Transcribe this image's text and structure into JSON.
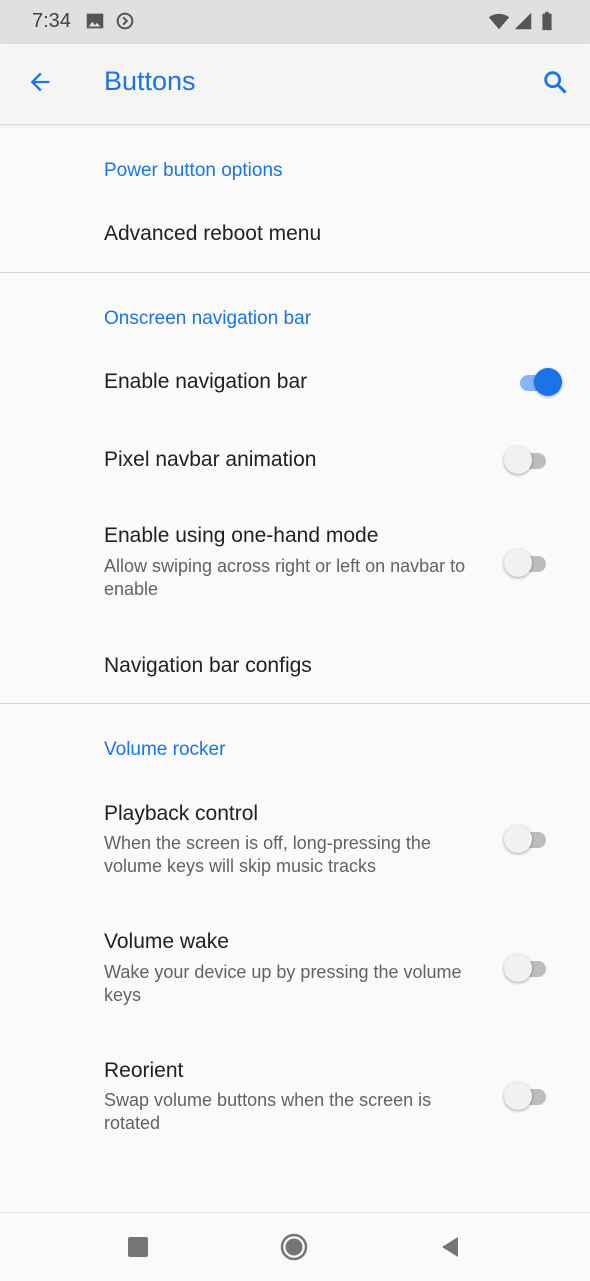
{
  "status_bar": {
    "time": "7:34",
    "icons": [
      "image-icon",
      "sync-icon",
      "wifi-icon",
      "signal-icon",
      "battery-icon"
    ]
  },
  "app_bar": {
    "title": "Buttons",
    "back_icon": "arrow-back-icon",
    "search_icon": "search-icon"
  },
  "sections": {
    "power": {
      "header": "Power button options",
      "advanced_reboot": "Advanced reboot menu"
    },
    "navbar": {
      "header": "Onscreen navigation bar",
      "enable_navbar": {
        "title": "Enable navigation bar",
        "checked": true
      },
      "pixel_anim": {
        "title": "Pixel navbar animation",
        "checked": false
      },
      "one_hand": {
        "title": "Enable using one-hand mode",
        "summary": "Allow swiping across right or left on navbar to enable",
        "checked": false
      },
      "configs": "Navigation bar configs"
    },
    "volume": {
      "header": "Volume rocker",
      "playback": {
        "title": "Playback control",
        "summary": "When the screen is off, long-pressing the volume keys will skip music tracks",
        "checked": false
      },
      "wake": {
        "title": "Volume wake",
        "summary": "Wake your device up by pressing the volume keys",
        "checked": false
      },
      "reorient": {
        "title": "Reorient",
        "summary": "Swap volume buttons when the screen is rotated",
        "checked": false
      }
    }
  },
  "colors": {
    "accent": "#1a73e8",
    "accent_light": "#8ab4f8",
    "background": "#fafafa",
    "status_bar": "#e0e0e0"
  },
  "nav_buttons": [
    "recents-icon",
    "home-icon",
    "back-icon"
  ]
}
